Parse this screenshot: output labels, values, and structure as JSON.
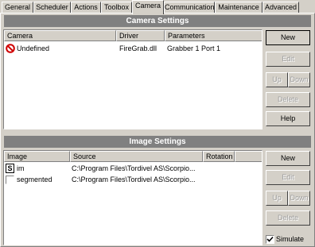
{
  "tabs": [
    "General",
    "Scheduler",
    "Actions",
    "Toolbox",
    "Camera",
    "Communication",
    "Maintenance",
    "Advanced"
  ],
  "active_tab": "Camera",
  "camera_settings": {
    "title": "Camera Settings",
    "columns": [
      "Camera",
      "Driver",
      "Parameters"
    ],
    "rows": [
      {
        "icon": "no-entry-icon",
        "camera": "Undefined",
        "driver": "FireGrab.dll",
        "parameters": "Grabber 1 Port 1"
      }
    ],
    "buttons": {
      "new": "New",
      "edit": "Edit",
      "up": "Up",
      "down": "Down",
      "delete": "Delete",
      "help": "Help"
    }
  },
  "image_settings": {
    "title": "Image Settings",
    "columns": [
      "Image",
      "Source",
      "Rotation"
    ],
    "rows": [
      {
        "marker": "S",
        "image": "im",
        "source": "C:\\Program Files\\Tordivel AS\\Scorpio...",
        "rotation": ""
      },
      {
        "marker": "",
        "image": "segmented",
        "source": "C:\\Program Files\\Tordivel AS\\Scorpio...",
        "rotation": ""
      }
    ],
    "buttons": {
      "new": "New",
      "edit": "Edit",
      "up": "Up",
      "down": "Down",
      "delete": "Delete"
    },
    "simulate": {
      "label": "Simulate",
      "checked": true
    }
  },
  "colors": {
    "face": "#d4d0c8",
    "header_band": "#808080",
    "no_entry_red": "#d00000"
  }
}
